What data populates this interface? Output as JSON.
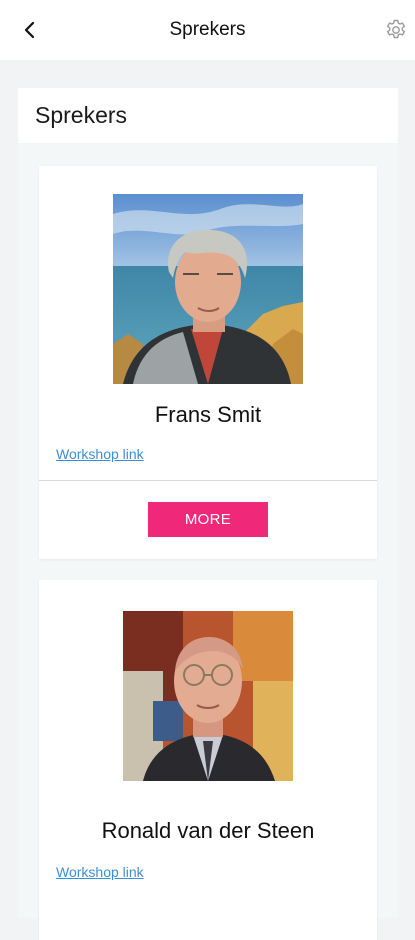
{
  "header": {
    "title": "Sprekers",
    "back_icon": "chevron-left-icon",
    "settings_icon": "gear-icon"
  },
  "section": {
    "title": "Sprekers"
  },
  "speakers": [
    {
      "name": "Frans Smit",
      "link_label": "Workshop link",
      "more_label": "MORE"
    },
    {
      "name": "Ronald van der Steen",
      "link_label": "Workshop link"
    }
  ],
  "colors": {
    "accent": "#f0287a",
    "link": "#3d8fd6",
    "background": "#f1f3f5"
  }
}
